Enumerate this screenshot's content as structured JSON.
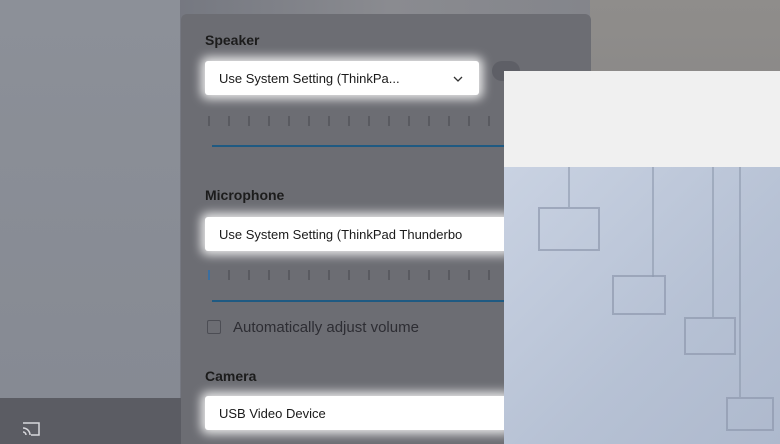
{
  "settings": {
    "speaker": {
      "title": "Speaker",
      "selected": "Use System Setting (ThinkPa..."
    },
    "microphone": {
      "title": "Microphone",
      "selected": "Use System Setting (ThinkPad Thunderbo"
    },
    "auto_adjust": {
      "label": "Automatically adjust volume",
      "checked": false
    },
    "camera": {
      "title": "Camera",
      "selected": "USB Video Device"
    }
  },
  "icons": {
    "cast": "cast-screen-icon",
    "chevron": "chevron-down-icon"
  },
  "colors": {
    "slider_track": "#1f5a82",
    "panel_bg": "#6c6d73"
  }
}
